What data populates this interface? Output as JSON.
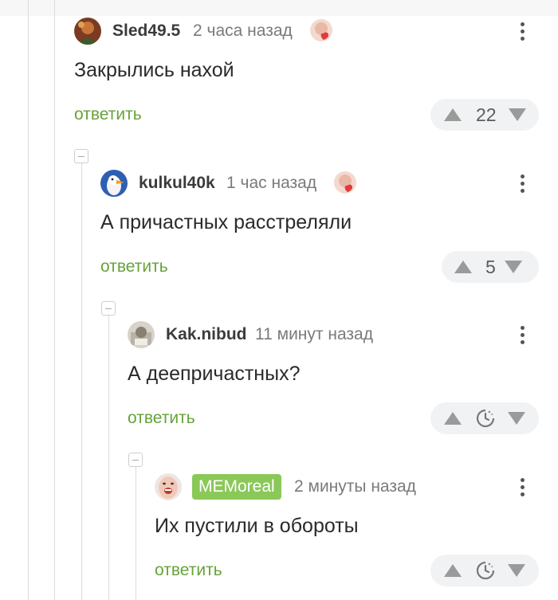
{
  "colors": {
    "reply_link": "#67a23a",
    "badge_bg": "#8ac858",
    "vote_bg": "#f1f2f4",
    "vote_arrow": "#9a9a9a"
  },
  "comments": [
    {
      "author": "Sled49.5",
      "time": "2 часа назад",
      "text": "Закрылись нахой",
      "reply_label": "ответить",
      "rating": "22",
      "avatar_icon": "user-avatar",
      "emoji_icon": "heart-face-sticker-icon"
    },
    {
      "author": "kulkul40k",
      "time": "1 час назад",
      "text": "А причастных расстреляли",
      "reply_label": "ответить",
      "rating": "5",
      "avatar_icon": "goose-avatar",
      "emoji_icon": "heart-face-sticker-icon"
    },
    {
      "author": "Kak.nibud",
      "time": "11 минут назад",
      "text": "А деепричастных?",
      "reply_label": "ответить",
      "rating_icon": "clock-icon",
      "avatar_icon": "user-avatar"
    },
    {
      "author": "MEMoreal",
      "time": "2 минуты назад",
      "text": "Их пустили в обороты",
      "reply_label": "ответить",
      "rating_icon": "clock-icon",
      "avatar_icon": "face-avatar",
      "author_badge": true
    }
  ]
}
